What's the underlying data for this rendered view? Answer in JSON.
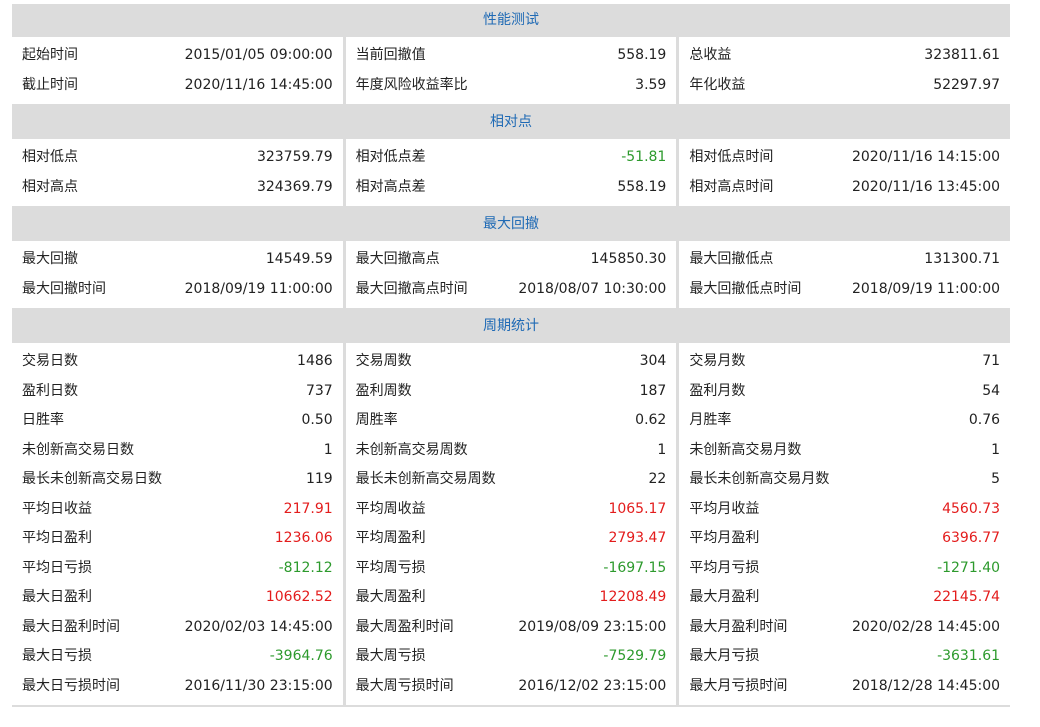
{
  "sections": [
    {
      "title": "性能测试",
      "columns": [
        [
          {
            "label": "起始时间",
            "value": "2015/01/05 09:00:00",
            "tone": ""
          },
          {
            "label": "截止时间",
            "value": "2020/11/16 14:45:00",
            "tone": ""
          }
        ],
        [
          {
            "label": "当前回撤值",
            "value": "558.19",
            "tone": ""
          },
          {
            "label": "年度风险收益率比",
            "value": "3.59",
            "tone": ""
          }
        ],
        [
          {
            "label": "总收益",
            "value": "323811.61",
            "tone": ""
          },
          {
            "label": "年化收益",
            "value": "52297.97",
            "tone": ""
          }
        ]
      ]
    },
    {
      "title": "相对点",
      "columns": [
        [
          {
            "label": "相对低点",
            "value": "323759.79",
            "tone": ""
          },
          {
            "label": "相对高点",
            "value": "324369.79",
            "tone": ""
          }
        ],
        [
          {
            "label": "相对低点差",
            "value": "-51.81",
            "tone": "neg"
          },
          {
            "label": "相对高点差",
            "value": "558.19",
            "tone": ""
          }
        ],
        [
          {
            "label": "相对低点时间",
            "value": "2020/11/16 14:15:00",
            "tone": ""
          },
          {
            "label": "相对高点时间",
            "value": "2020/11/16 13:45:00",
            "tone": ""
          }
        ]
      ]
    },
    {
      "title": "最大回撤",
      "columns": [
        [
          {
            "label": "最大回撤",
            "value": "14549.59",
            "tone": ""
          },
          {
            "label": "最大回撤时间",
            "value": "2018/09/19 11:00:00",
            "tone": ""
          }
        ],
        [
          {
            "label": "最大回撤高点",
            "value": "145850.30",
            "tone": ""
          },
          {
            "label": "最大回撤高点时间",
            "value": "2018/08/07 10:30:00",
            "tone": ""
          }
        ],
        [
          {
            "label": "最大回撤低点",
            "value": "131300.71",
            "tone": ""
          },
          {
            "label": "最大回撤低点时间",
            "value": "2018/09/19 11:00:00",
            "tone": ""
          }
        ]
      ]
    },
    {
      "title": "周期统计",
      "columns": [
        [
          {
            "label": "交易日数",
            "value": "1486",
            "tone": ""
          },
          {
            "label": "盈利日数",
            "value": "737",
            "tone": ""
          },
          {
            "label": "日胜率",
            "value": "0.50",
            "tone": ""
          },
          {
            "label": "未创新高交易日数",
            "value": "1",
            "tone": ""
          },
          {
            "label": "最长未创新高交易日数",
            "value": "119",
            "tone": ""
          },
          {
            "label": "平均日收益",
            "value": "217.91",
            "tone": "pos"
          },
          {
            "label": "平均日盈利",
            "value": "1236.06",
            "tone": "pos"
          },
          {
            "label": "平均日亏损",
            "value": "-812.12",
            "tone": "neg"
          },
          {
            "label": "最大日盈利",
            "value": "10662.52",
            "tone": "pos"
          },
          {
            "label": "最大日盈利时间",
            "value": "2020/02/03 14:45:00",
            "tone": ""
          },
          {
            "label": "最大日亏损",
            "value": "-3964.76",
            "tone": "neg"
          },
          {
            "label": "最大日亏损时间",
            "value": "2016/11/30 23:15:00",
            "tone": ""
          }
        ],
        [
          {
            "label": "交易周数",
            "value": "304",
            "tone": ""
          },
          {
            "label": "盈利周数",
            "value": "187",
            "tone": ""
          },
          {
            "label": "周胜率",
            "value": "0.62",
            "tone": ""
          },
          {
            "label": "未创新高交易周数",
            "value": "1",
            "tone": ""
          },
          {
            "label": "最长未创新高交易周数",
            "value": "22",
            "tone": ""
          },
          {
            "label": "平均周收益",
            "value": "1065.17",
            "tone": "pos"
          },
          {
            "label": "平均周盈利",
            "value": "2793.47",
            "tone": "pos"
          },
          {
            "label": "平均周亏损",
            "value": "-1697.15",
            "tone": "neg"
          },
          {
            "label": "最大周盈利",
            "value": "12208.49",
            "tone": "pos"
          },
          {
            "label": "最大周盈利时间",
            "value": "2019/08/09 23:15:00",
            "tone": ""
          },
          {
            "label": "最大周亏损",
            "value": "-7529.79",
            "tone": "neg"
          },
          {
            "label": "最大周亏损时间",
            "value": "2016/12/02 23:15:00",
            "tone": ""
          }
        ],
        [
          {
            "label": "交易月数",
            "value": "71",
            "tone": ""
          },
          {
            "label": "盈利月数",
            "value": "54",
            "tone": ""
          },
          {
            "label": "月胜率",
            "value": "0.76",
            "tone": ""
          },
          {
            "label": "未创新高交易月数",
            "value": "1",
            "tone": ""
          },
          {
            "label": "最长未创新高交易月数",
            "value": "5",
            "tone": ""
          },
          {
            "label": "平均月收益",
            "value": "4560.73",
            "tone": "pos"
          },
          {
            "label": "平均月盈利",
            "value": "6396.77",
            "tone": "pos"
          },
          {
            "label": "平均月亏损",
            "value": "-1271.40",
            "tone": "neg"
          },
          {
            "label": "最大月盈利",
            "value": "22145.74",
            "tone": "pos"
          },
          {
            "label": "最大月盈利时间",
            "value": "2020/02/28 14:45:00",
            "tone": ""
          },
          {
            "label": "最大月亏损",
            "value": "-3631.61",
            "tone": "neg"
          },
          {
            "label": "最大月亏损时间",
            "value": "2018/12/28 14:45:00",
            "tone": ""
          }
        ]
      ]
    }
  ],
  "colors": {
    "header_bg": "#dcdcdc",
    "header_text": "#1f6ab5",
    "positive": "#e31c1c",
    "negative": "#2d9a2d"
  }
}
